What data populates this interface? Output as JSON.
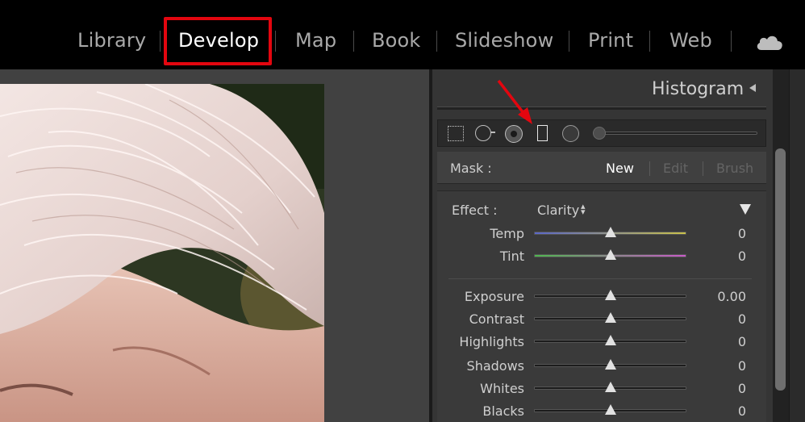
{
  "modules": {
    "library": "Library",
    "develop": "Develop",
    "map": "Map",
    "book": "Book",
    "slideshow": "Slideshow",
    "print": "Print",
    "web": "Web",
    "active": "Develop",
    "highlight_color": "#e3060f"
  },
  "histogram": {
    "title": "Histogram"
  },
  "tools": [
    "crop-overlay",
    "spot-removal",
    "red-eye",
    "graduated-filter",
    "radial-filter",
    "adjustment-brush"
  ],
  "mask": {
    "label": "Mask :",
    "new": "New",
    "edit": "Edit",
    "brush": "Brush"
  },
  "effect": {
    "label": "Effect :",
    "value": "Clarity",
    "sliders": [
      {
        "name": "Temp",
        "value": "0",
        "position": 0.5
      },
      {
        "name": "Tint",
        "value": "0",
        "position": 0.5
      },
      {
        "name": "Exposure",
        "value": "0.00",
        "position": 0.5
      },
      {
        "name": "Contrast",
        "value": "0",
        "position": 0.5
      },
      {
        "name": "Highlights",
        "value": "0",
        "position": 0.5
      },
      {
        "name": "Shadows",
        "value": "0",
        "position": 0.5
      },
      {
        "name": "Whites",
        "value": "0",
        "position": 0.5
      },
      {
        "name": "Blacks",
        "value": "0",
        "position": 0.5
      }
    ]
  },
  "colors": {
    "temp_gradient": [
      "#5a67c8",
      "#c9c14a"
    ],
    "tint_gradient": [
      "#4fb64f",
      "#c85ac8"
    ]
  }
}
